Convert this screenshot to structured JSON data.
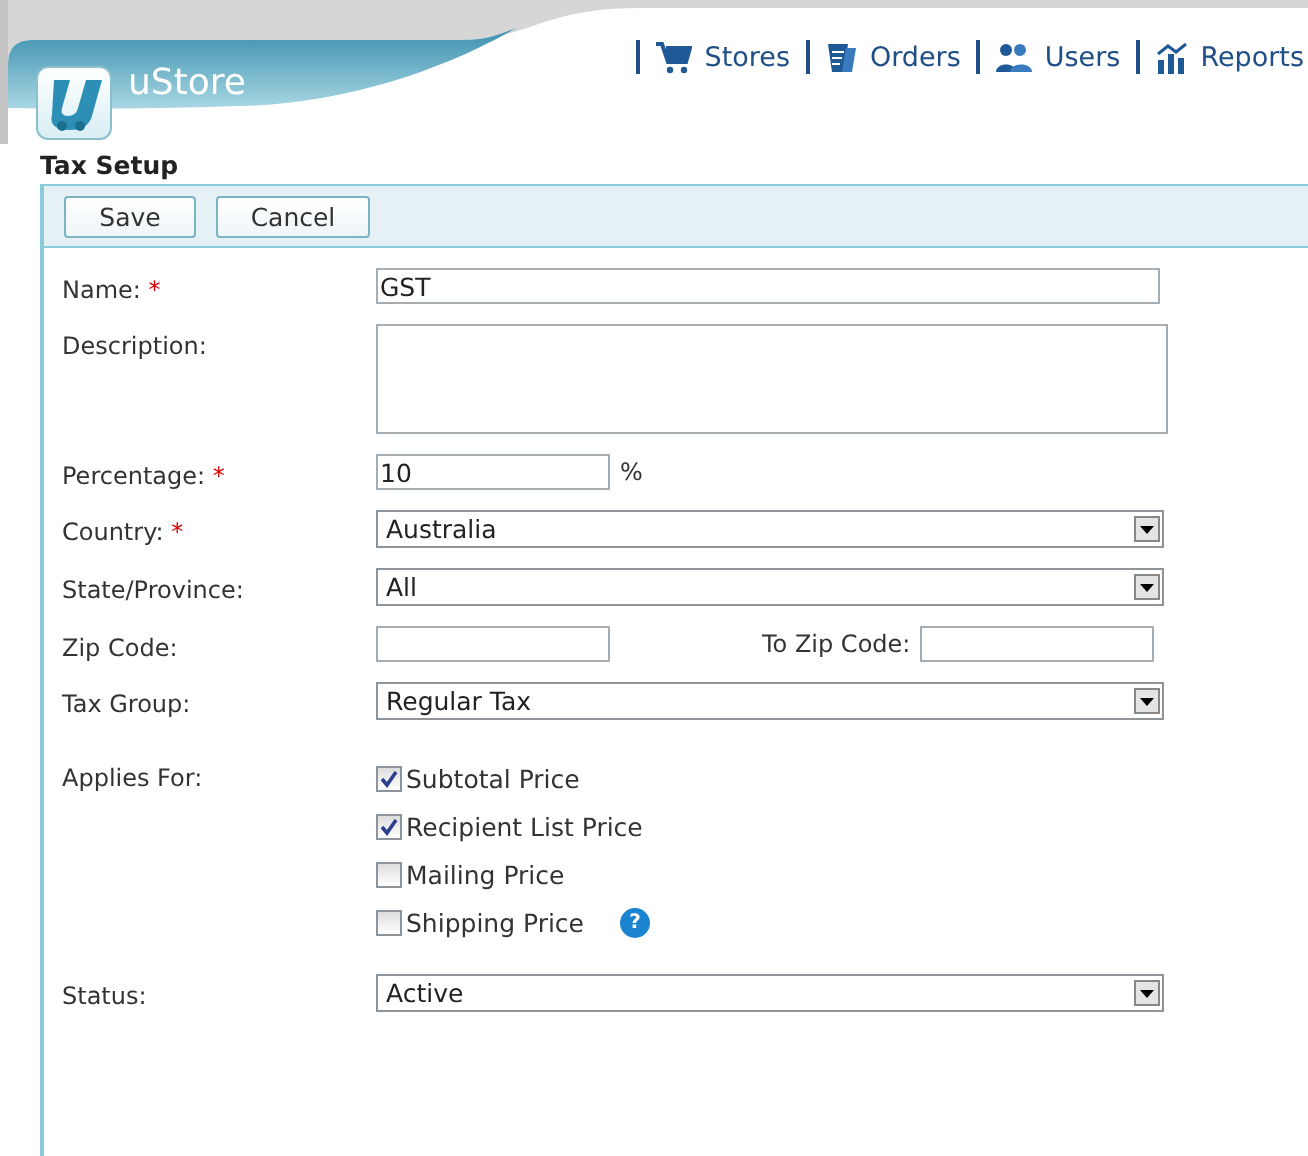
{
  "header": {
    "app_name": "uStore",
    "nav": [
      {
        "label": "Stores",
        "kind": "cart"
      },
      {
        "label": "Orders",
        "kind": "orders"
      },
      {
        "label": "Users",
        "kind": "users"
      },
      {
        "label": "Reports",
        "kind": "reports"
      }
    ]
  },
  "page_title": "Tax Setup",
  "toolbar": {
    "buttons": [
      "Save",
      "Cancel"
    ]
  },
  "form": [
    {
      "kind": "text",
      "label": "Name:",
      "mark": "*",
      "value": "GST"
    },
    {
      "kind": "textarea",
      "label": "Description:"
    },
    {
      "kind": "short",
      "label": "Percentage:",
      "mark": "*",
      "value": "10",
      "suffix": "%"
    },
    {
      "kind": "select",
      "label": "Country:",
      "mark": "*",
      "value": "Australia"
    },
    {
      "kind": "select",
      "label": "State/Province:",
      "value": "All"
    },
    {
      "kind": "range",
      "label": "Zip Code:",
      "second_label": "To Zip Code:"
    },
    {
      "kind": "select",
      "label": "Tax Group:",
      "value": "Regular Tax"
    },
    {
      "kind": "checks",
      "label": "Applies For:",
      "options": [
        {
          "label": "Subtotal Price",
          "checked": true
        },
        {
          "label": "Recipient List Price",
          "checked": true
        },
        {
          "label": "Mailing Price",
          "checked": false
        },
        {
          "label": "Shipping Price",
          "checked": false,
          "help": "?"
        }
      ]
    },
    {
      "kind": "select",
      "label": "Status:",
      "value": "Active"
    }
  ]
}
